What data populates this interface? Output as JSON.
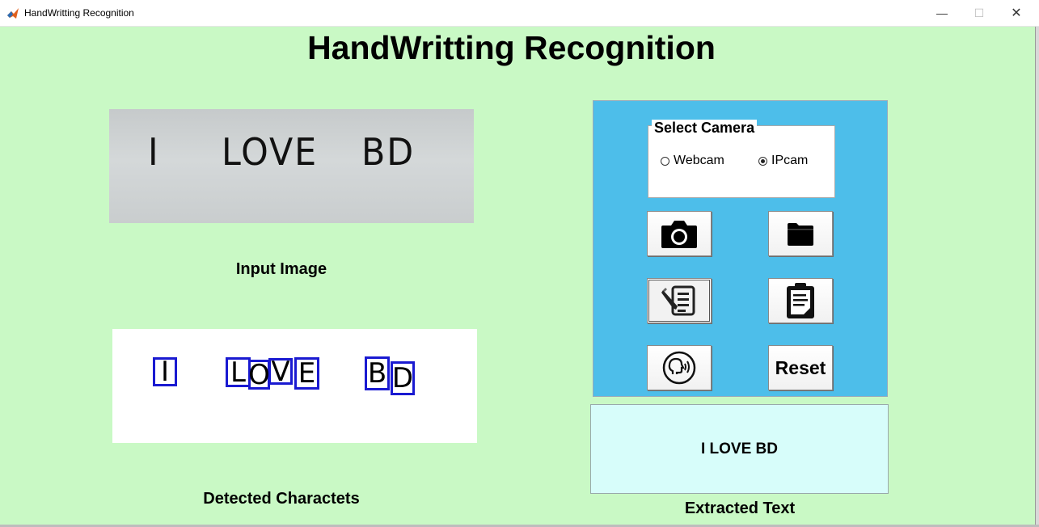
{
  "window": {
    "title": "HandWritting Recognition",
    "controls": {
      "minimize": "—",
      "maximize": "☐",
      "close": "✕"
    }
  },
  "main": {
    "title": "HandWritting Recognition",
    "input_image": {
      "handwritten_words": [
        "I",
        "LOVE",
        "BD"
      ]
    },
    "input_label": "Input Image",
    "detected_characters": [
      "I",
      "L",
      "O",
      "V",
      "E",
      "B",
      "D"
    ],
    "detected_label": "Detected Charactets"
  },
  "control_panel": {
    "background_color": "#4dbeea",
    "camera_group": {
      "title": "Select Camera",
      "options": [
        {
          "label": "Webcam",
          "selected": false
        },
        {
          "label": "IPcam",
          "selected": true
        }
      ]
    },
    "buttons": [
      {
        "icon": "camera-icon"
      },
      {
        "icon": "folder-icon"
      },
      {
        "icon": "document-edit-icon"
      },
      {
        "icon": "clipboard-icon"
      },
      {
        "icon": "speaking-head-icon"
      },
      {
        "label": "Reset"
      }
    ]
  },
  "output": {
    "text": "I LOVE BD",
    "label": "Extracted Text",
    "background_color": "#d7fdfa"
  },
  "colors": {
    "figure_background": "#c9f9c5",
    "box_outline": "#1a1ad1"
  }
}
